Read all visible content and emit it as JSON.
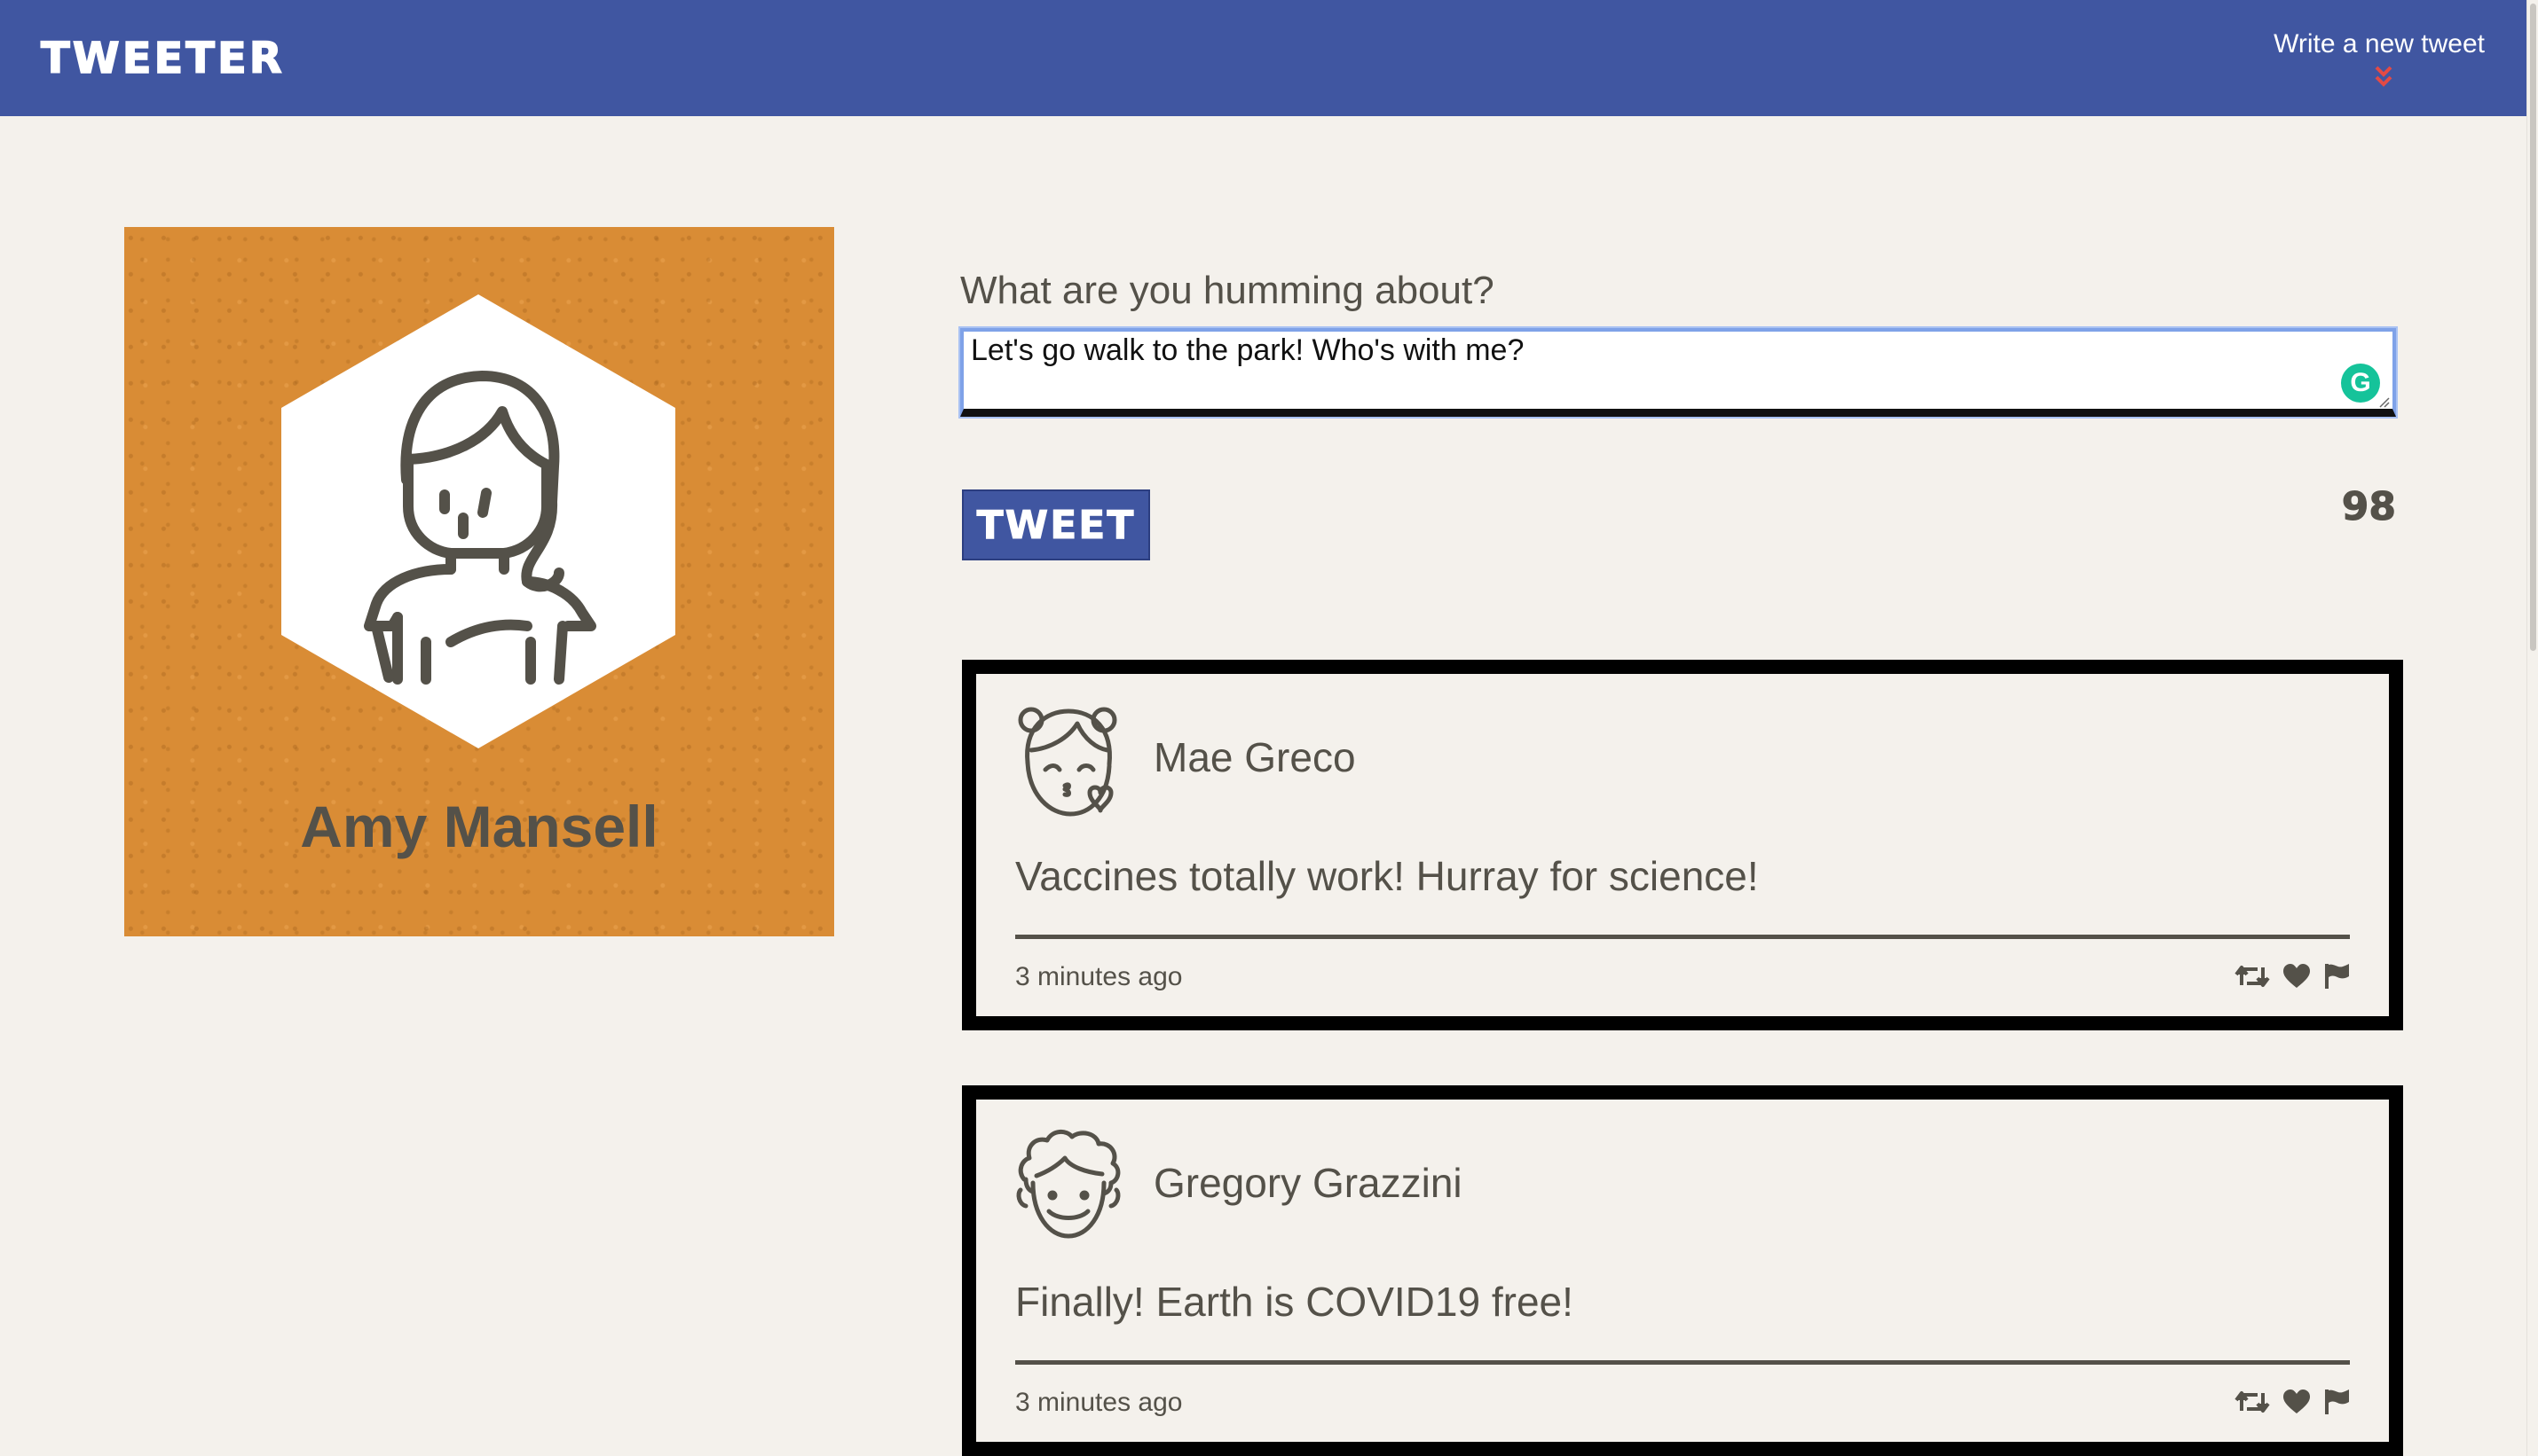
{
  "nav": {
    "brand": "TWEETER",
    "compose_label": "Write a new tweet",
    "compose_icon": "double-chevron-down-icon"
  },
  "colors": {
    "nav_bg": "#4056a1",
    "page_bg": "#f4f1ec",
    "profile_bg": "#d98c35",
    "text": "#545149",
    "chevron": "#e34a45",
    "grammarly": "#15c39a"
  },
  "profile": {
    "name": "Amy Mansell",
    "avatar_icon": "woman-avatar-icon"
  },
  "composer": {
    "label": "What are you humming about?",
    "value": "Let's go walk to the park! Who's with me?",
    "submit_label": "TWEET",
    "char_count": "98"
  },
  "tweets": [
    {
      "author": "Mae Greco",
      "avatar_icon": "girl-blowing-kiss-avatar-icon",
      "content": "Vaccines totally work! Hurray for science!",
      "time": "3 minutes ago",
      "actions": [
        "retweet-icon",
        "heart-icon",
        "flag-icon"
      ]
    },
    {
      "author": "Gregory Grazzini",
      "avatar_icon": "curly-hair-man-avatar-icon",
      "content": "Finally! Earth is COVID19 free!",
      "time": "3 minutes ago",
      "actions": [
        "retweet-icon",
        "heart-icon",
        "flag-icon"
      ]
    }
  ]
}
